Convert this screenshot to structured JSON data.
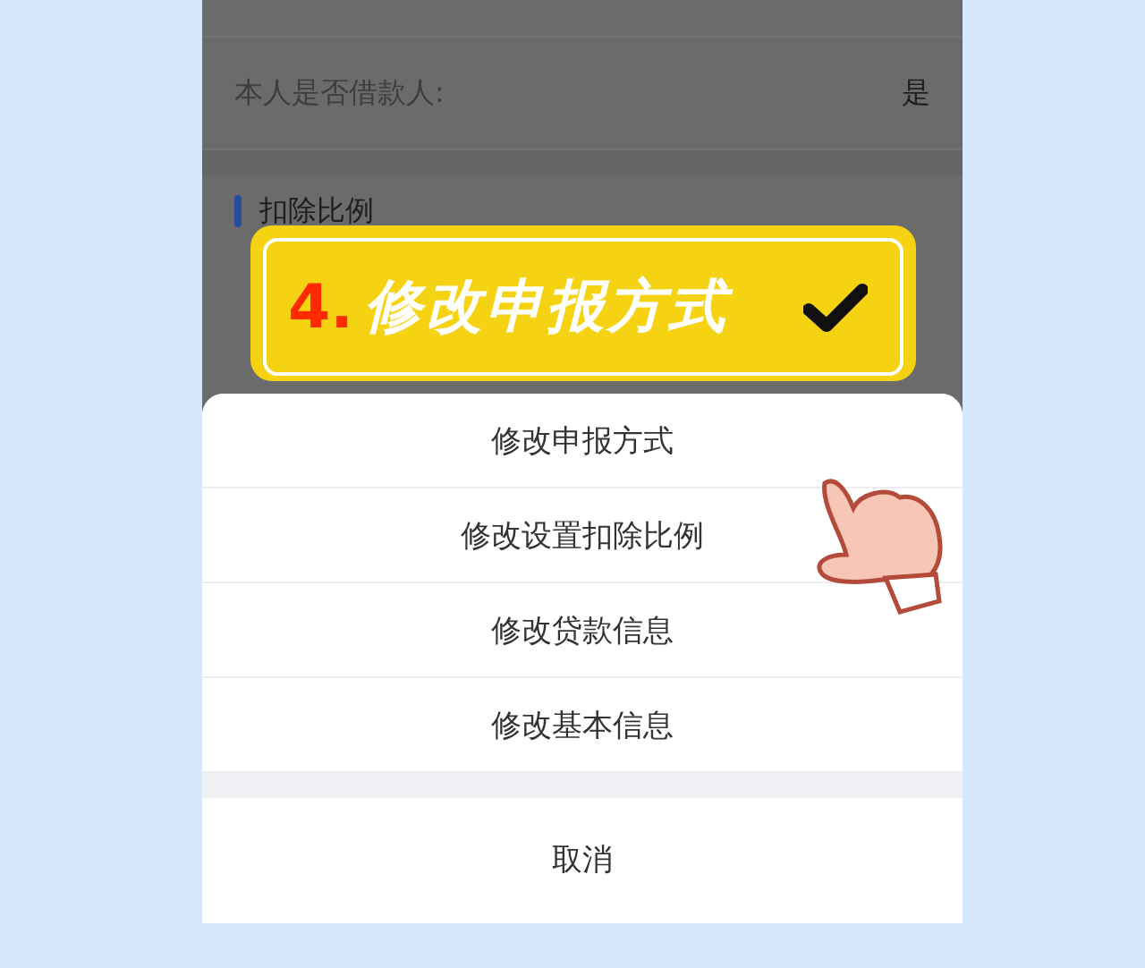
{
  "background_rows": [
    {
      "label": "本人是否借款人:",
      "value": "是"
    }
  ],
  "section": {
    "title": "扣除比例"
  },
  "banner": {
    "number": "4.",
    "title": "修改申报方式"
  },
  "action_sheet": {
    "items": [
      "修改申报方式",
      "修改设置扣除比例",
      "修改贷款信息",
      "修改基本信息"
    ],
    "cancel": "取消"
  }
}
